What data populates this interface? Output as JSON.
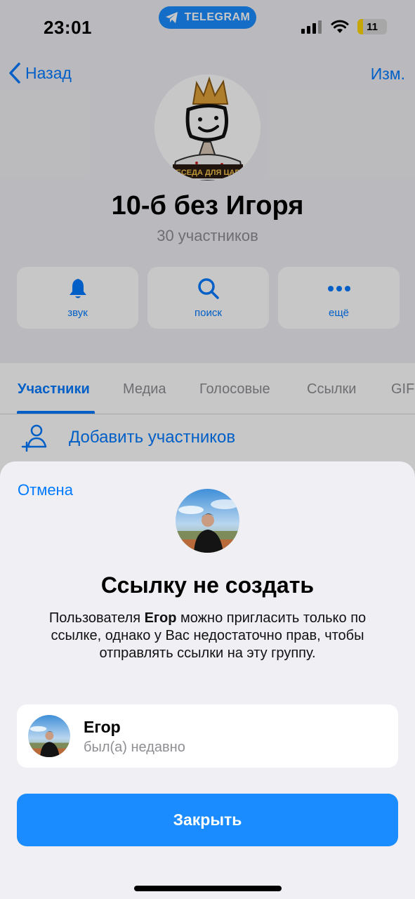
{
  "status_bar": {
    "time": "23:01",
    "app_pill": "TELEGRAM",
    "battery": "11",
    "icons": [
      "signal-icon",
      "wifi-icon",
      "battery-icon"
    ]
  },
  "nav": {
    "back_label": "Назад",
    "edit_label": "Изм."
  },
  "group": {
    "name": "10-б без Игоря",
    "members_count": "30 участников",
    "avatar_caption": "БЕСЕДА ДЛЯ ЦАРЯ"
  },
  "actions": [
    {
      "label": "звук",
      "icon": "bell-icon"
    },
    {
      "label": "поиск",
      "icon": "search-icon"
    },
    {
      "label": "ещё",
      "icon": "more-icon"
    }
  ],
  "tabs": [
    "Участники",
    "Медиа",
    "Голосовые",
    "Ссылки",
    "GIF"
  ],
  "active_tab": "Участники",
  "add_members_label": "Добавить участников",
  "sheet": {
    "cancel_label": "Отмена",
    "title": "Ссылку не создать",
    "message_prefix": "Пользователя ",
    "message_user": "Егор",
    "message_suffix": " можно пригласить только по ссылке, однако у Вас недостаточно прав, чтобы отправлять ссылки на эту группу.",
    "user_name": "Егор",
    "user_status": "был(а) недавно",
    "close_label": "Закрыть"
  },
  "colors": {
    "accent": "#007aff",
    "button": "#1a8cff",
    "background": "#efeff4",
    "secondary_text": "#8e8e93"
  }
}
